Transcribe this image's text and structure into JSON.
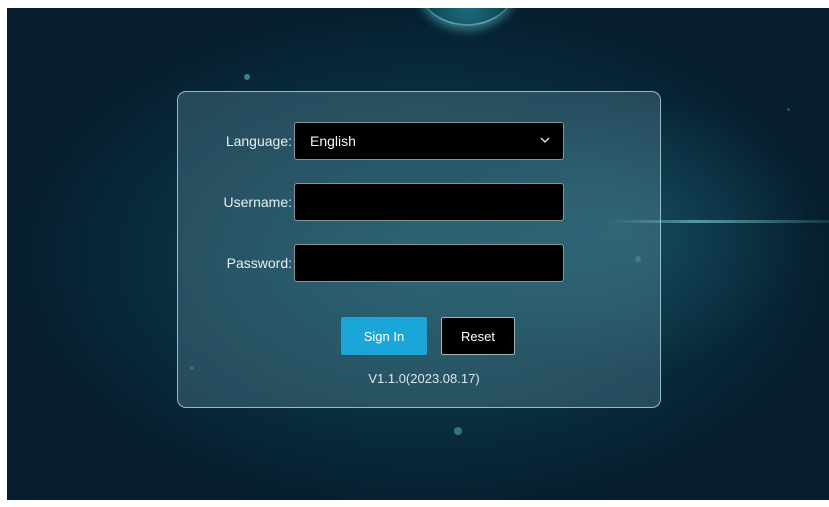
{
  "login": {
    "language_label": "Language:",
    "language_value": "English",
    "username_label": "Username:",
    "username_value": "",
    "password_label": "Password:",
    "password_value": "",
    "signin_label": "Sign In",
    "reset_label": "Reset",
    "version": "V1.1.0(2023.08.17)"
  },
  "icons": {
    "language_dropdown": "chevron-down-icon"
  },
  "colors": {
    "background": "#0b3645",
    "signin_button": "#1aa6d8",
    "field_background": "#000000",
    "panel_border": "#bee1e6"
  }
}
